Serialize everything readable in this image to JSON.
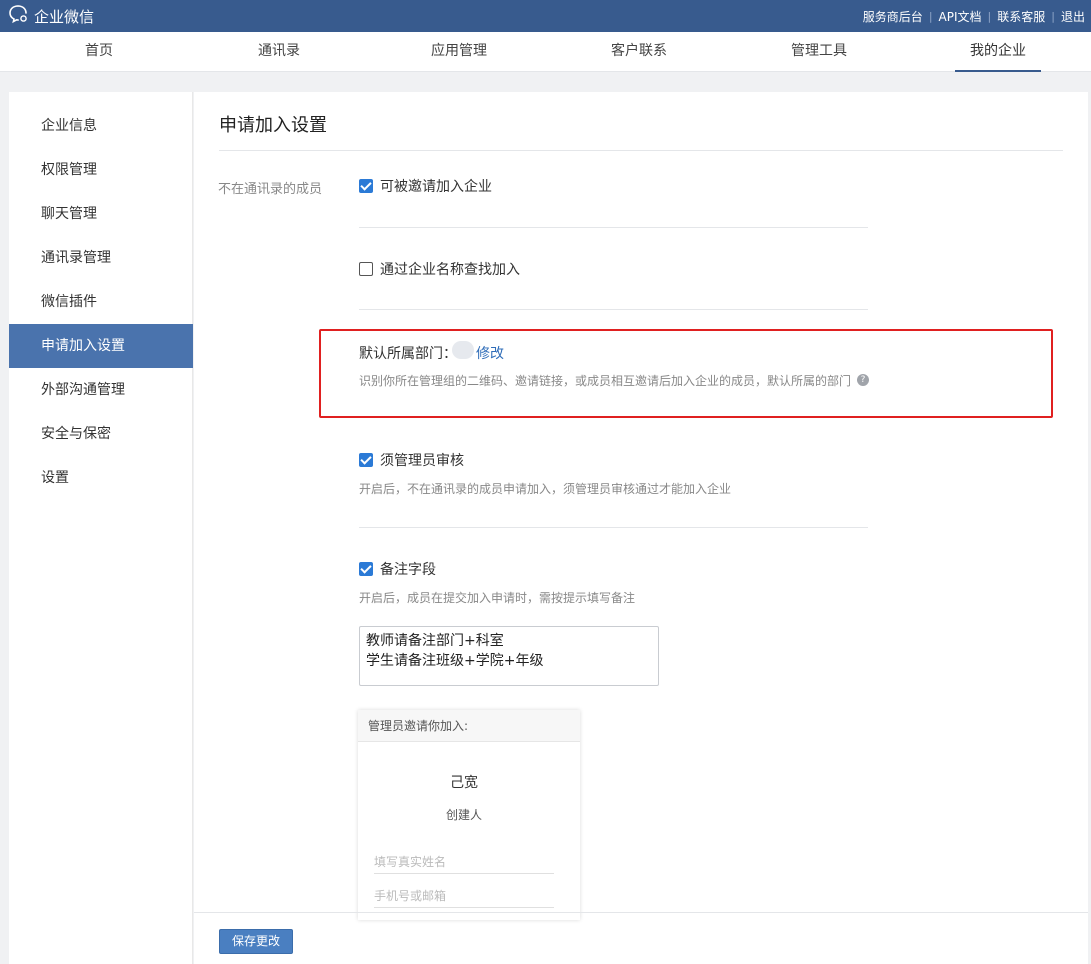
{
  "topbar": {
    "logo_text": "企业微信",
    "links": [
      "服务商后台",
      "API文档",
      "联系客服",
      "退出"
    ]
  },
  "nav": {
    "tabs": [
      "首页",
      "通讯录",
      "应用管理",
      "客户联系",
      "管理工具",
      "我的企业"
    ],
    "active": "我的企业"
  },
  "sidebar": {
    "items": [
      "企业信息",
      "权限管理",
      "聊天管理",
      "通讯录管理",
      "微信插件",
      "申请加入设置",
      "外部沟通管理",
      "安全与保密",
      "设置"
    ],
    "active": "申请加入设置"
  },
  "main": {
    "title": "申请加入设置",
    "row_label": "不在通讯录的成员",
    "invite_option": {
      "label": "可被邀请加入企业",
      "checked": true
    },
    "search_option": {
      "label": "通过企业名称查找加入",
      "checked": false
    },
    "default_dept": {
      "label": "默认所属部门：",
      "edit_link": "修改",
      "hint": "识别你所在管理组的二维码、邀请链接，或成员相互邀请后加入企业的成员，默认所属的部门"
    },
    "admin_review": {
      "label": "须管理员审核",
      "checked": true,
      "hint": "开启后，不在通讯录的成员申请加入，须管理员审核通过才能加入企业"
    },
    "remark_field": {
      "label": "备注字段",
      "checked": true,
      "hint": "开启后，成员在提交加入申请时，需按提示填写备注"
    },
    "remark_text": "教师请备注部门+科室\n学生请备注班级+学院+年级",
    "preview_card": {
      "header": "管理员邀请你加入:",
      "name": "己宽",
      "role": "创建人",
      "name_placeholder": "填写真实姓名",
      "contact_placeholder": "手机号或邮箱"
    },
    "save_label": "保存更改"
  },
  "colors": {
    "topbar": "#385b8e",
    "accent": "#4a73ad",
    "checkbox": "#2b7ad6",
    "highlight_border": "#e02020",
    "link": "#2e6cb8"
  },
  "icons": [
    "wecom-logo-icon",
    "checkbox-checked-icon",
    "checkbox-unchecked-icon",
    "help-icon"
  ]
}
